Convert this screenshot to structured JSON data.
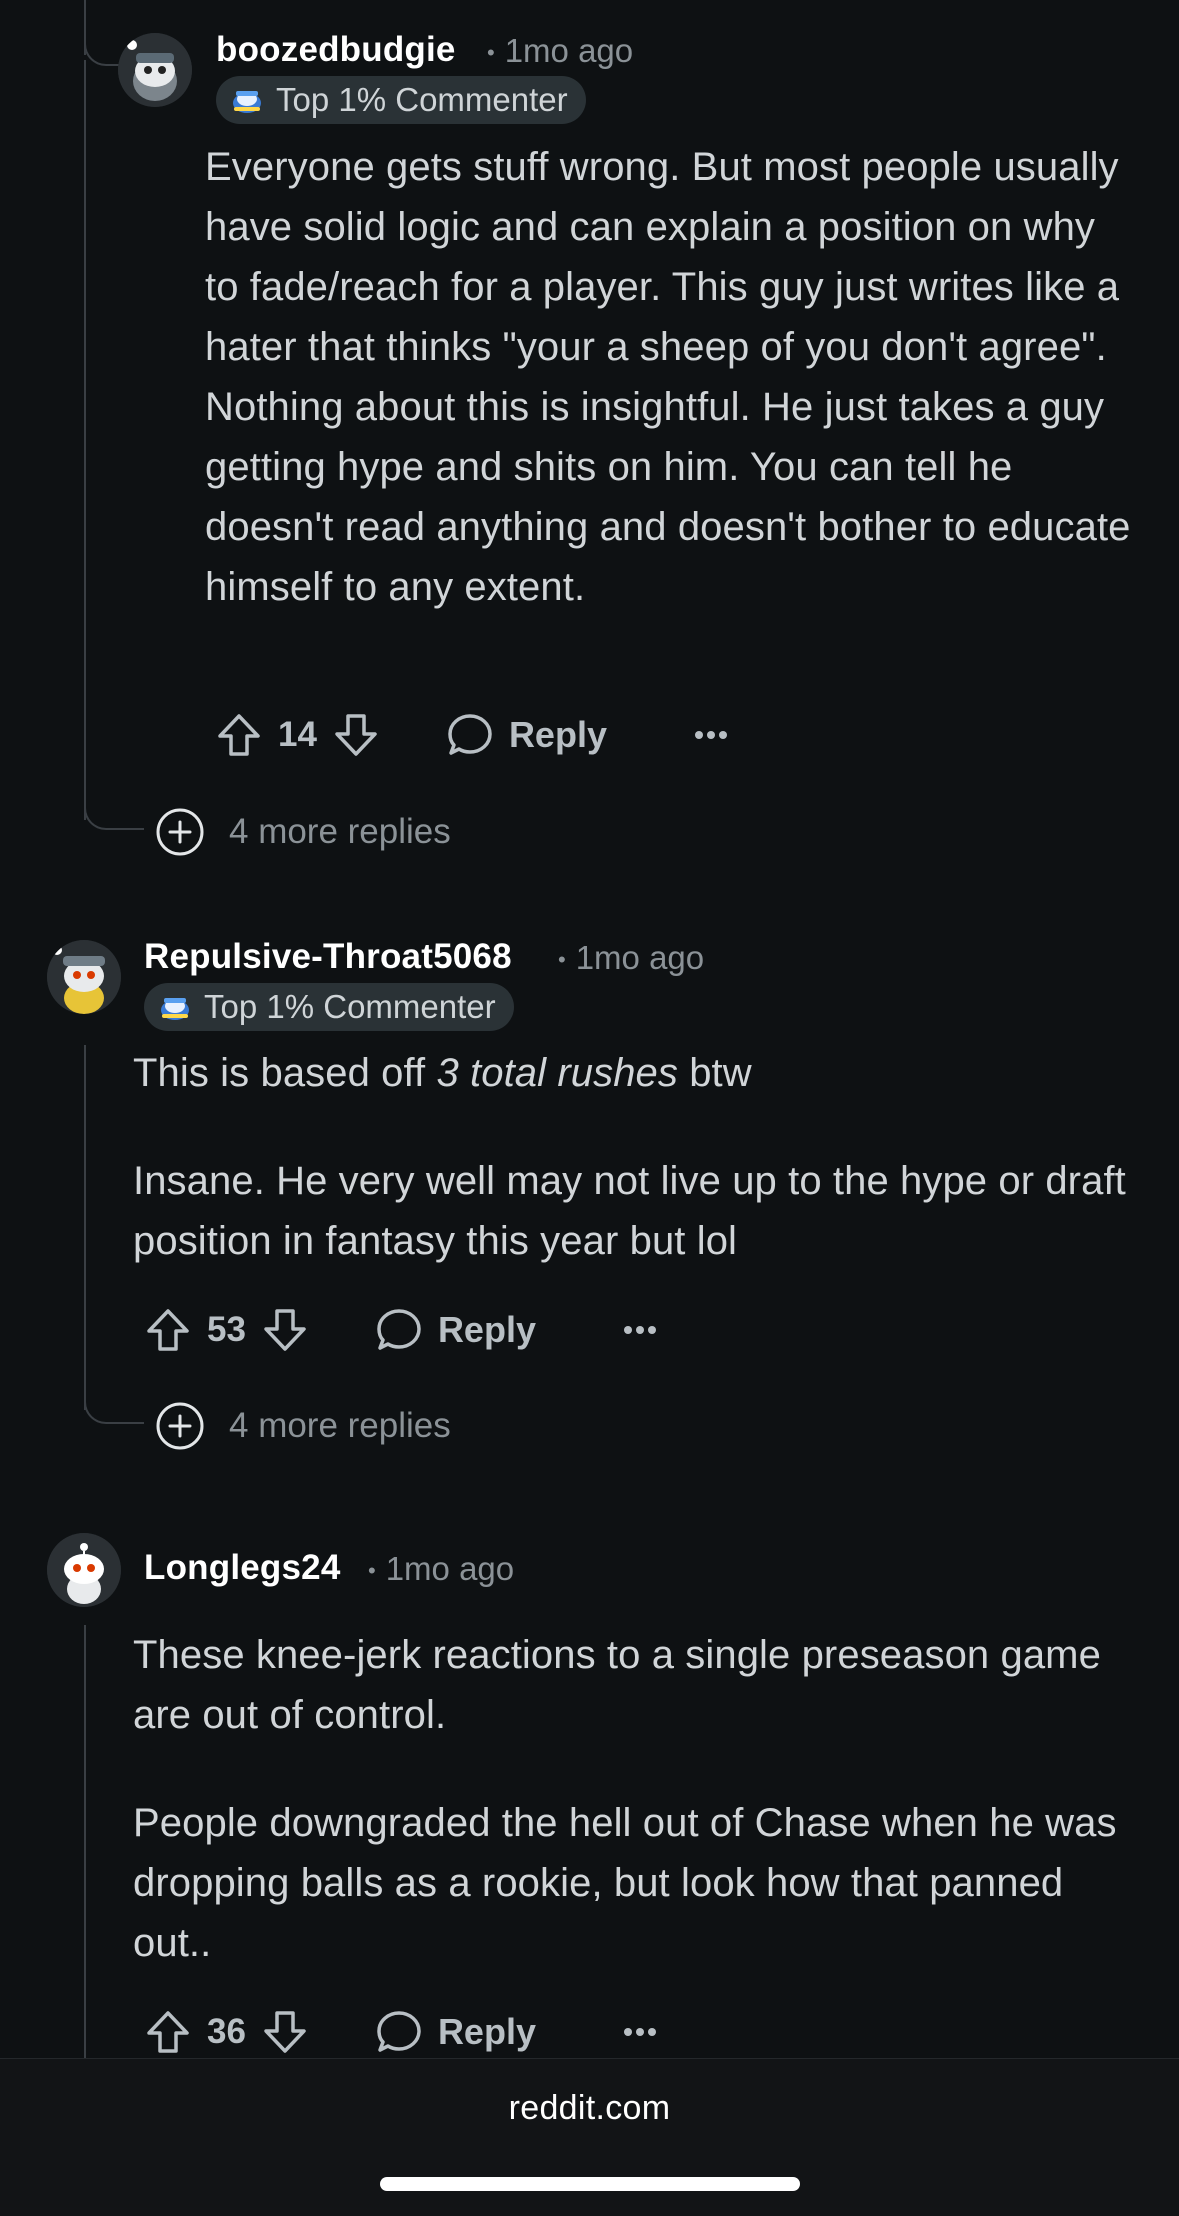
{
  "comments": [
    {
      "username": "boozedbudgie",
      "time": "1mo ago",
      "flair": "Top 1% Commenter",
      "body": "Everyone gets stuff wrong. But most people usually have solid logic and can explain a position on why to fade/reach for a player. This guy just writes like a hater that thinks \"your a sheep of you don't agree\". Nothing about this is insightful. He just takes a guy getting hype and shits on him. You can tell he doesn't read anything and doesn't bother to educate himself to any extent.",
      "votes": "14",
      "reply_label": "Reply",
      "more_replies": "4 more replies"
    },
    {
      "username": "Repulsive-Throat5068",
      "time": "1mo ago",
      "flair": "Top 1% Commenter",
      "body_p1_before": "This is based off ",
      "body_p1_italic": "3 total rushes",
      "body_p1_after": " btw",
      "body_p2": "Insane. He very well may not live up to the hype or draft position in fantasy this year but lol",
      "votes": "53",
      "reply_label": "Reply",
      "more_replies": "4 more replies"
    },
    {
      "username": "Longlegs24",
      "time": "1mo ago",
      "body_p1": "These knee-jerk reactions to a single preseason game are out of control.",
      "body_p2": "People downgraded the hell out of Chase when he was dropping balls as a rookie, but look how that panned out..",
      "votes": "36",
      "reply_label": "Reply"
    }
  ],
  "footer": {
    "domain": "reddit.com"
  },
  "icons": {
    "upvote": "upvote-arrow-icon",
    "downvote": "downvote-arrow-icon",
    "reply": "speech-bubble-icon",
    "more": "ellipsis-icon",
    "expand": "plus-circle-icon",
    "flair": "snoo-flair-icon"
  }
}
